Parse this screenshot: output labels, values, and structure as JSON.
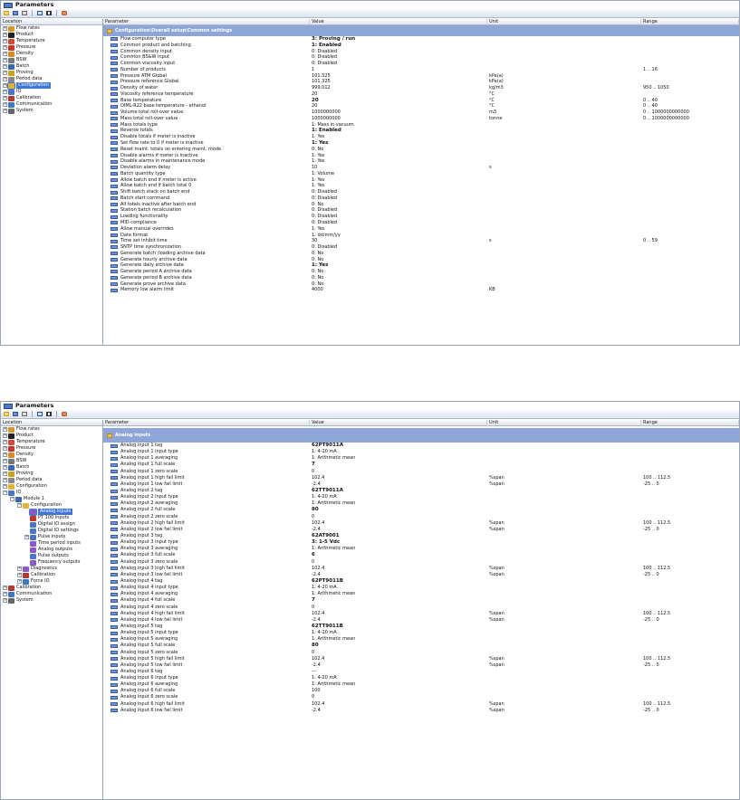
{
  "panel1": {
    "title": "Parameters",
    "headers": {
      "location": "Location",
      "parameter": "Parameter",
      "value": "Value",
      "unit": "Unit",
      "range": "Range"
    },
    "tree": [
      {
        "label": "Flow rates",
        "exp": "+",
        "indent": 0,
        "color": "#d9962b"
      },
      {
        "label": "Product",
        "exp": "+",
        "indent": 0,
        "color": "#222"
      },
      {
        "label": "Temperature",
        "exp": "+",
        "indent": 0,
        "color": "#d24b3a"
      },
      {
        "label": "Pressure",
        "exp": "+",
        "indent": 0,
        "color": "#c0392b"
      },
      {
        "label": "Density",
        "exp": "+",
        "indent": 0,
        "color": "#d88a2b"
      },
      {
        "label": "BSW",
        "exp": "+",
        "indent": 0,
        "color": "#777"
      },
      {
        "label": "Batch",
        "exp": "+",
        "indent": 0,
        "color": "#3a66b0"
      },
      {
        "label": "Proving",
        "exp": "+",
        "indent": 0,
        "color": "#c9a21e"
      },
      {
        "label": "Period data",
        "exp": "+",
        "indent": 0,
        "color": "#888"
      },
      {
        "label": "Configuration",
        "exp": "+",
        "indent": 0,
        "color": "#e1b23a",
        "selected": true
      },
      {
        "label": "IO",
        "exp": "+",
        "indent": 0,
        "color": "#4a76c4"
      },
      {
        "label": "Calibration",
        "exp": "+",
        "indent": 0,
        "color": "#b03a2e"
      },
      {
        "label": "Communication",
        "exp": "+",
        "indent": 0,
        "color": "#3c7ac2"
      },
      {
        "label": "System",
        "exp": "+",
        "indent": 0,
        "color": "#666"
      }
    ],
    "section": "Configuration\\Overall setup\\Common settings",
    "rows": [
      {
        "p": "Flow computer type",
        "v": "3: Proving / run",
        "u": "",
        "r": "",
        "b": true
      },
      {
        "p": "Common product and batching",
        "v": "1: Enabled",
        "u": "",
        "r": "",
        "b": true
      },
      {
        "p": "Common density input",
        "v": "0: Disabled",
        "u": "",
        "r": ""
      },
      {
        "p": "Common BS&W input",
        "v": "0: Disabled",
        "u": "",
        "r": ""
      },
      {
        "p": "Common viscosity input",
        "v": "0: Disabled",
        "u": "",
        "r": ""
      },
      {
        "p": "Number of products",
        "v": "1",
        "u": "",
        "r": "1 .. 16"
      },
      {
        "p": "Pressure ATM Global",
        "v": "101.325",
        "u": "kPa(a)",
        "r": ""
      },
      {
        "p": "Pressure reference Global",
        "v": "101.325",
        "u": "kPa(a)",
        "r": ""
      },
      {
        "p": "Density of water",
        "v": "999.012",
        "u": "kg/m3",
        "r": "950 .. 1050"
      },
      {
        "p": "Viscosity reference temperature",
        "v": "20",
        "u": "°C",
        "r": ""
      },
      {
        "p": "Base temperature",
        "v": "20",
        "u": "°C",
        "r": "0 .. 40",
        "b": true
      },
      {
        "p": "OIML-R22 base temperature - ethanol",
        "v": "20",
        "u": "°C",
        "r": "0 .. 40"
      },
      {
        "p": "Volume total roll-over value",
        "v": "1000000000",
        "u": "m3",
        "r": "0 .. 1000000000000"
      },
      {
        "p": "Mass total roll-over value",
        "v": "1000000000",
        "u": "tonne",
        "r": "0 .. 1000000000000"
      },
      {
        "p": "Mass totals type",
        "v": "1: Mass in vacuum",
        "u": "",
        "r": ""
      },
      {
        "p": "Reverse totals",
        "v": "1: Enabled",
        "u": "",
        "r": "",
        "b": true
      },
      {
        "p": "Disable totals if meter is inactive",
        "v": "1: Yes",
        "u": "",
        "r": ""
      },
      {
        "p": "Set flow rate to 0 if meter is inactive",
        "v": "1: Yes",
        "u": "",
        "r": "",
        "b": true
      },
      {
        "p": "Reset maint. totals on entering maint. mode",
        "v": "0: No",
        "u": "",
        "r": ""
      },
      {
        "p": "Disable alarms if meter is inactive",
        "v": "1: Yes",
        "u": "",
        "r": ""
      },
      {
        "p": "Disable alarms in maintenance mode",
        "v": "1: Yes",
        "u": "",
        "r": ""
      },
      {
        "p": "Deviation alarm delay",
        "v": "10",
        "u": "s",
        "r": ""
      },
      {
        "p": "Batch quantity type",
        "v": "1: Volume",
        "u": "",
        "r": ""
      },
      {
        "p": "Allow batch end if meter is active",
        "v": "1: Yes",
        "u": "",
        "r": ""
      },
      {
        "p": "Allow batch end if batch total 0",
        "v": "1: Yes",
        "u": "",
        "r": ""
      },
      {
        "p": "Shift batch stack on batch end",
        "v": "0: Disabled",
        "u": "",
        "r": ""
      },
      {
        "p": "Batch start command",
        "v": "0: Disabled",
        "u": "",
        "r": ""
      },
      {
        "p": "All totals inactive after batch end",
        "v": "0: No",
        "u": "",
        "r": ""
      },
      {
        "p": "Station batch recalculation",
        "v": "0: Disabled",
        "u": "",
        "r": ""
      },
      {
        "p": "Loading functionality",
        "v": "0: Disabled",
        "u": "",
        "r": ""
      },
      {
        "p": "MID compliance",
        "v": "0: Disabled",
        "u": "",
        "r": ""
      },
      {
        "p": "Allow manual overrides",
        "v": "1: Yes",
        "u": "",
        "r": ""
      },
      {
        "p": "Date format",
        "v": "1: dd/mm/yy",
        "u": "",
        "r": ""
      },
      {
        "p": "Time set inhibit time",
        "v": "30",
        "u": "s",
        "r": "0 .. 59"
      },
      {
        "p": "SNTP time synchronization",
        "v": "0: Disabled",
        "u": "",
        "r": ""
      },
      {
        "p": "Generate batch /loading archive data",
        "v": "0: No",
        "u": "",
        "r": ""
      },
      {
        "p": "Generate hourly archive data",
        "v": "0: No",
        "u": "",
        "r": ""
      },
      {
        "p": "Generate daily archive data",
        "v": "1: Yes",
        "u": "",
        "r": "",
        "b": true
      },
      {
        "p": "Generate period A archive data",
        "v": "0: No",
        "u": "",
        "r": ""
      },
      {
        "p": "Generate period B archive data",
        "v": "0: No",
        "u": "",
        "r": ""
      },
      {
        "p": "Generate prove archive data",
        "v": "0: No",
        "u": "",
        "r": ""
      },
      {
        "p": "Memory low alarm limit",
        "v": "4000",
        "u": "KB",
        "r": ""
      }
    ]
  },
  "panel2": {
    "title": "Parameters",
    "headers": {
      "location": "Location",
      "parameter": "Parameter",
      "value": "Value",
      "unit": "Unit",
      "range": "Range"
    },
    "tree": [
      {
        "label": "Flow rates",
        "exp": "+",
        "indent": 0,
        "color": "#d9962b"
      },
      {
        "label": "Product",
        "exp": "+",
        "indent": 0,
        "color": "#222"
      },
      {
        "label": "Temperature",
        "exp": "+",
        "indent": 0,
        "color": "#d24b3a"
      },
      {
        "label": "Pressure",
        "exp": "+",
        "indent": 0,
        "color": "#c0392b"
      },
      {
        "label": "Density",
        "exp": "+",
        "indent": 0,
        "color": "#d88a2b"
      },
      {
        "label": "BSW",
        "exp": "+",
        "indent": 0,
        "color": "#777"
      },
      {
        "label": "Batch",
        "exp": "+",
        "indent": 0,
        "color": "#3a66b0"
      },
      {
        "label": "Proving",
        "exp": "+",
        "indent": 0,
        "color": "#c9a21e"
      },
      {
        "label": "Period data",
        "exp": "+",
        "indent": 0,
        "color": "#888"
      },
      {
        "label": "Configuration",
        "exp": "+",
        "indent": 0,
        "color": "#e1b23a"
      },
      {
        "label": "IO",
        "exp": "-",
        "indent": 0,
        "color": "#4a76c4"
      },
      {
        "label": "Module 1",
        "exp": "-",
        "indent": 1,
        "color": "#3a66b0"
      },
      {
        "label": "Configuration",
        "exp": "-",
        "indent": 2,
        "color": "#e1b23a"
      },
      {
        "label": "Analog inputs",
        "exp": "",
        "indent": 3,
        "color": "#8a5bc8",
        "selected": true
      },
      {
        "label": "PT 100 inputs",
        "exp": "",
        "indent": 3,
        "color": "#c0392b"
      },
      {
        "label": "Digital IO assign",
        "exp": "",
        "indent": 3,
        "color": "#4a76c4"
      },
      {
        "label": "Digital IO settings",
        "exp": "",
        "indent": 3,
        "color": "#4a76c4"
      },
      {
        "label": "Pulse inputs",
        "exp": "+",
        "indent": 3,
        "color": "#4a76c4"
      },
      {
        "label": "Time period inputs",
        "exp": "",
        "indent": 3,
        "color": "#8a5bc8"
      },
      {
        "label": "Analog outputs",
        "exp": "",
        "indent": 3,
        "color": "#8a5bc8"
      },
      {
        "label": "Pulse outputs",
        "exp": "",
        "indent": 3,
        "color": "#4a76c4"
      },
      {
        "label": "Frequency outputs",
        "exp": "",
        "indent": 3,
        "color": "#8a5bc8"
      },
      {
        "label": "Diagnostics",
        "exp": "+",
        "indent": 2,
        "color": "#8a5bc8"
      },
      {
        "label": "Calibration",
        "exp": "+",
        "indent": 2,
        "color": "#b03a2e"
      },
      {
        "label": "Force IO",
        "exp": "+",
        "indent": 2,
        "color": "#3c7ac2"
      },
      {
        "label": "Calibration",
        "exp": "+",
        "indent": 0,
        "color": "#b03a2e"
      },
      {
        "label": "Communication",
        "exp": "+",
        "indent": 0,
        "color": "#3c7ac2"
      },
      {
        "label": "System",
        "exp": "+",
        "indent": 0,
        "color": "#666"
      }
    ],
    "section": "Analog inputs",
    "rows": [
      {
        "p": "Analog input 1 tag",
        "v": "62PT9011A",
        "u": "",
        "r": "",
        "b": true
      },
      {
        "p": "Analog input 1 input type",
        "v": "1: 4-20 mA",
        "u": "",
        "r": ""
      },
      {
        "p": "Analog input 1 averaging",
        "v": "1: Arithmetic mean",
        "u": "",
        "r": ""
      },
      {
        "p": "Analog input 1 full scale",
        "v": "7",
        "u": "",
        "r": "",
        "b": true
      },
      {
        "p": "Analog input 1 zero scale",
        "v": "0",
        "u": "",
        "r": ""
      },
      {
        "p": "Analog input 1 high fail limit",
        "v": "102.4",
        "u": "%span",
        "r": "100 .. 112.5"
      },
      {
        "p": "Analog input 1 low fail limit",
        "v": "-2.4",
        "u": "%span",
        "r": "-25 .. 0"
      },
      {
        "p": "Analog input 2 tag",
        "v": "62TT9011A",
        "u": "",
        "r": "",
        "b": true
      },
      {
        "p": "Analog input 2 input type",
        "v": "1: 4-20 mA",
        "u": "",
        "r": ""
      },
      {
        "p": "Analog input 2 averaging",
        "v": "1: Arithmetic mean",
        "u": "",
        "r": ""
      },
      {
        "p": "Analog input 2 full scale",
        "v": "80",
        "u": "",
        "r": "",
        "b": true
      },
      {
        "p": "Analog input 2 zero scale",
        "v": "0",
        "u": "",
        "r": ""
      },
      {
        "p": "Analog input 2 high fail limit",
        "v": "102.4",
        "u": "%span",
        "r": "100 .. 112.5"
      },
      {
        "p": "Analog input 2 low fail limit",
        "v": "-2.4",
        "u": "%span",
        "r": "-25 .. 0"
      },
      {
        "p": "Analog input 3 tag",
        "v": "62AT9001",
        "u": "",
        "r": "",
        "b": true
      },
      {
        "p": "Analog input 3 input type",
        "v": "3: 1-5 Vdc",
        "u": "",
        "r": "",
        "b": true
      },
      {
        "p": "Analog input 3 averaging",
        "v": "1: Arithmetic mean",
        "u": "",
        "r": ""
      },
      {
        "p": "Analog input 3 full scale",
        "v": "6",
        "u": "",
        "r": "",
        "b": true
      },
      {
        "p": "Analog input 3 zero scale",
        "v": "0",
        "u": "",
        "r": ""
      },
      {
        "p": "Analog input 3 high fail limit",
        "v": "102.4",
        "u": "%span",
        "r": "100 .. 112.5"
      },
      {
        "p": "Analog input 3 low fail limit",
        "v": "-2.4",
        "u": "%span",
        "r": "-25 .. 0"
      },
      {
        "p": "Analog input 4 tag",
        "v": "62PT9011B",
        "u": "",
        "r": "",
        "b": true
      },
      {
        "p": "Analog input 4 input type",
        "v": "1: 4-20 mA",
        "u": "",
        "r": ""
      },
      {
        "p": "Analog input 4 averaging",
        "v": "1: Arithmetic mean",
        "u": "",
        "r": ""
      },
      {
        "p": "Analog input 4 full scale",
        "v": "7",
        "u": "",
        "r": "",
        "b": true
      },
      {
        "p": "Analog input 4 zero scale",
        "v": "0",
        "u": "",
        "r": ""
      },
      {
        "p": "Analog input 4 high fail limit",
        "v": "102.4",
        "u": "%span",
        "r": "100 .. 112.5"
      },
      {
        "p": "Analog input 4 low fail limit",
        "v": "-2.4",
        "u": "%span",
        "r": "-25 .. 0"
      },
      {
        "p": "Analog input 5 tag",
        "v": "62TT9011B",
        "u": "",
        "r": "",
        "b": true
      },
      {
        "p": "Analog input 5 input type",
        "v": "1: 4-20 mA",
        "u": "",
        "r": ""
      },
      {
        "p": "Analog input 5 averaging",
        "v": "1: Arithmetic mean",
        "u": "",
        "r": ""
      },
      {
        "p": "Analog input 5 full scale",
        "v": "80",
        "u": "",
        "r": "",
        "b": true
      },
      {
        "p": "Analog input 5 zero scale",
        "v": "0",
        "u": "",
        "r": ""
      },
      {
        "p": "Analog input 5 high fail limit",
        "v": "102.4",
        "u": "%span",
        "r": "100 .. 112.5"
      },
      {
        "p": "Analog input 5 low fail limit",
        "v": "-2.4",
        "u": "%span",
        "r": "-25 .. 0"
      },
      {
        "p": "Analog input 6 tag",
        "v": "---",
        "u": "",
        "r": ""
      },
      {
        "p": "Analog input 6 input type",
        "v": "1: 4-20 mA",
        "u": "",
        "r": ""
      },
      {
        "p": "Analog input 6 averaging",
        "v": "1: Arithmetic mean",
        "u": "",
        "r": ""
      },
      {
        "p": "Analog input 6 full scale",
        "v": "100",
        "u": "",
        "r": ""
      },
      {
        "p": "Analog input 6 zero scale",
        "v": "0",
        "u": "",
        "r": ""
      },
      {
        "p": "Analog input 6 high fail limit",
        "v": "102.4",
        "u": "%span",
        "r": "100 .. 112.5"
      },
      {
        "p": "Analog input 6 low fail limit",
        "v": "-2.4",
        "u": "%span",
        "r": "-25 .. 0"
      }
    ]
  },
  "toolbar": {
    "icons": [
      "open-icon",
      "save-icon",
      "print-icon",
      "tree-icon",
      "columns-icon",
      "tools-icon"
    ]
  },
  "colors": {
    "section": "#8ea5d8",
    "selection": "#3d76d6"
  }
}
